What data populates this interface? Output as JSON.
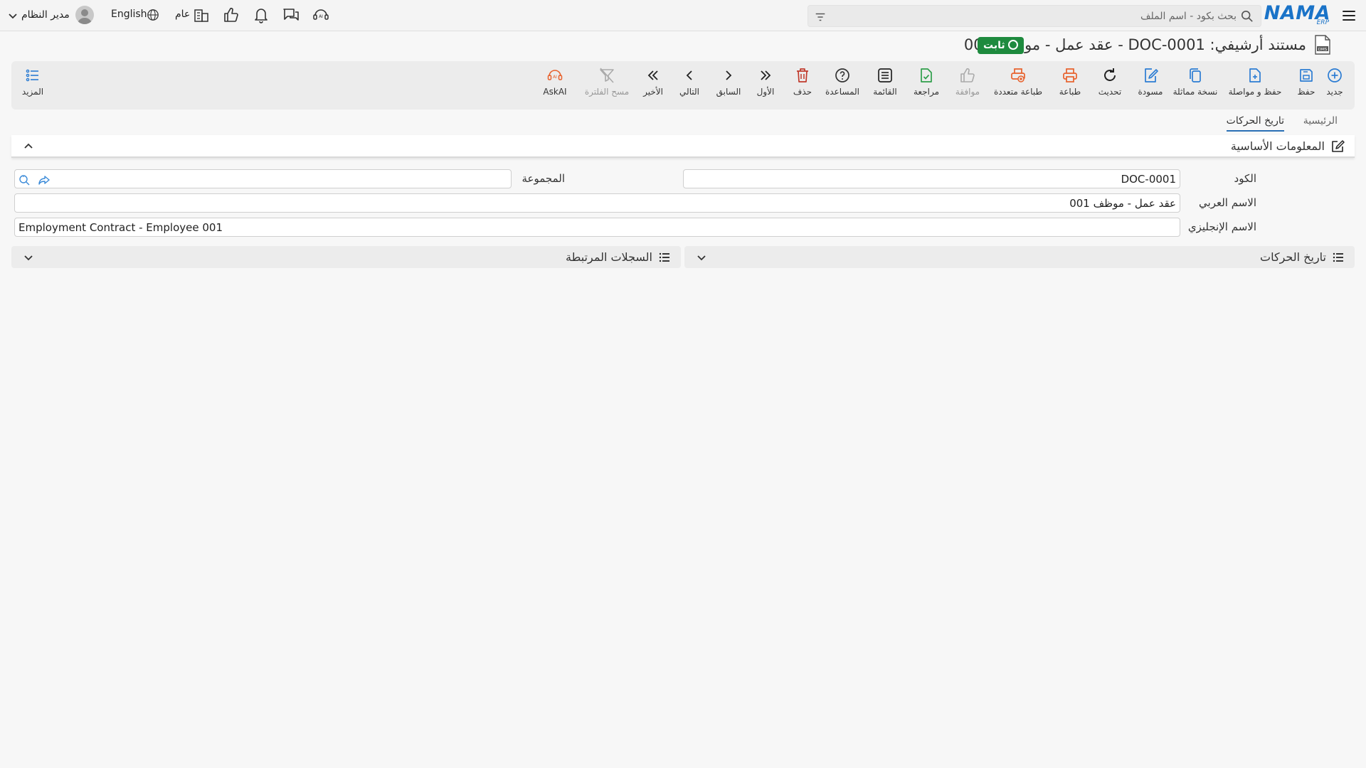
{
  "header": {
    "logo_text": "NAMA",
    "logo_sub": "ERP",
    "search_placeholder": "بحث بكود - اسم الملف",
    "language_label": "English",
    "branch_label": "عام",
    "user_name": "مدير النظام"
  },
  "title": {
    "text": "مستند أرشيفي: DOC-0001 - عقد عمل - موظف 001",
    "status": "ثابت",
    "status_color": "#1e8a3e"
  },
  "toolbar": {
    "new": "جديد",
    "save": "حفظ",
    "save_continue": "حفظ و مواصلة",
    "duplicate": "نسخة مماثلة",
    "draft": "مسودة",
    "refresh": "تحديث",
    "print": "طباعة",
    "multi_print": "طباعة متعددة",
    "approve": "موافقة",
    "review": "مراجعة",
    "list": "القائمة",
    "help": "المساعدة",
    "delete": "حذف",
    "first": "الأول",
    "previous": "السابق",
    "next": "التالي",
    "last": "الأخير",
    "clear_filter": "مسح الفلترة",
    "ask_ai": "AskAI",
    "more": "المزيد"
  },
  "tabs": {
    "main": "الرئيسية",
    "history": "تاريخ الحركات"
  },
  "basic_info": {
    "title": "المعلومات الأساسية",
    "code_label": "الكود",
    "code_value": "DOC-0001",
    "group_label": "المجموعة",
    "group_value": "",
    "arabic_name_label": "الاسم العربي",
    "arabic_name_value": "عقد عمل - موظف 001",
    "english_name_label": "الاسم الإنجليزي",
    "english_name_value": "Employment Contract - Employee 001"
  },
  "panels": {
    "history": "تاريخ الحركات",
    "related": "السجلات المرتبطة"
  },
  "colors": {
    "accent_blue": "#1a73c8",
    "save_blue": "#2b7cd3",
    "print_orange": "#e8612c",
    "review_green": "#2e9e4a",
    "delete_red": "#c0392b"
  }
}
